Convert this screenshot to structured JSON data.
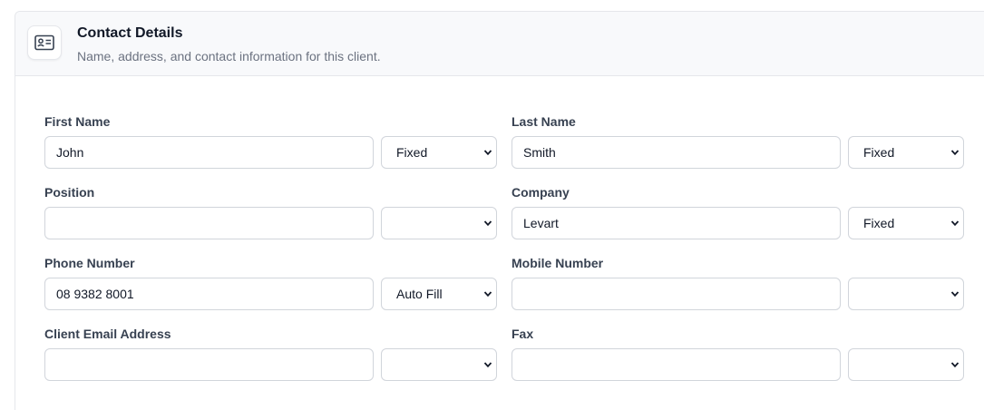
{
  "section": {
    "title": "Contact Details",
    "subtitle": "Name, address, and contact information for this client.",
    "icon": "contact-card-icon"
  },
  "fields": {
    "first_name": {
      "label": "First Name",
      "value": "John",
      "mode": "Fixed"
    },
    "last_name": {
      "label": "Last Name",
      "value": "Smith",
      "mode": "Fixed"
    },
    "position": {
      "label": "Position",
      "value": "",
      "mode": ""
    },
    "company": {
      "label": "Company",
      "value": "Levart",
      "mode": "Fixed"
    },
    "phone_number": {
      "label": "Phone Number",
      "value": "08 9382 8001",
      "mode": "Auto Fill"
    },
    "mobile_number": {
      "label": "Mobile Number",
      "value": "",
      "mode": ""
    },
    "client_email": {
      "label": "Client Email Address",
      "value": "",
      "mode": ""
    },
    "fax": {
      "label": "Fax",
      "value": "",
      "mode": ""
    }
  },
  "colors": {
    "header_bg": "#f8f9fb",
    "border": "#d1d5db",
    "label": "#374151",
    "subtitle": "#6b7280"
  }
}
